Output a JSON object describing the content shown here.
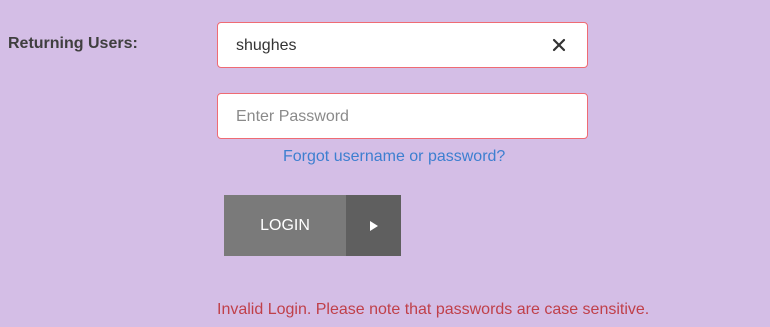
{
  "login_form": {
    "returning_users_label": "Returning Users:",
    "username": {
      "value": "shughes"
    },
    "password": {
      "value": "",
      "placeholder": "Enter Password"
    },
    "forgot_link": "Forgot username or password?",
    "login_button_label": "LOGIN",
    "error_message": "Invalid Login. Please note that passwords are case sensitive."
  },
  "icons": {
    "clear": "close-icon",
    "login_arrow": "play-arrow-icon"
  },
  "colors": {
    "background": "#d4bee6",
    "field_border": "#ef6b73",
    "link": "#3d7fd0",
    "error": "#c0404a",
    "button": "#7a7a7a",
    "button_arrow": "#5f5f5f"
  }
}
